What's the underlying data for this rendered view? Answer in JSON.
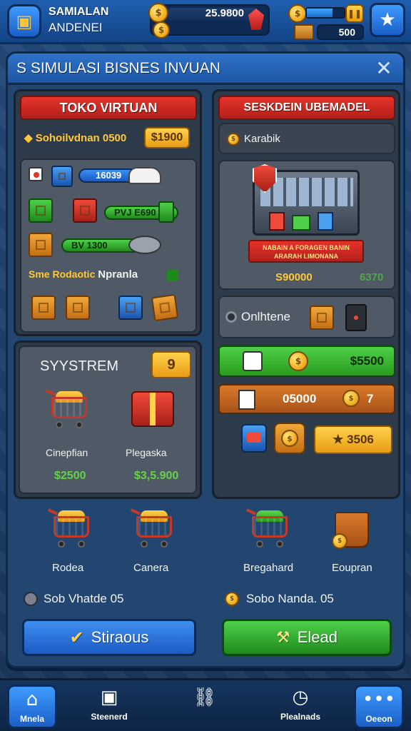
{
  "hud": {
    "title_line1": "SAMIALAN",
    "title_line2": "ANDENEI",
    "money": "25.9800",
    "box_value": "500",
    "energy_fraction": 0.7
  },
  "panel": {
    "title": "S SIMULASI BISNES INVUAN",
    "close": "✕"
  },
  "left": {
    "header": "TOKO VIRTUAN",
    "summary_label": "Sohoilvdnan 0500",
    "summary_value": "$1900",
    "bar1": "16039",
    "bar2": "PVJ E690",
    "bar3": "BV   1300",
    "status_label": "Sme Rodaotic",
    "status_value": "Npranla",
    "system_title": "SYYSTREM",
    "system_badge": "9",
    "item1_label": "Cinepfian",
    "item1_value": "$2500",
    "item2_label": "Plegaska",
    "item2_value": "$3,5.900"
  },
  "right": {
    "header": "SESKDEIN UBEMADEL",
    "sub_label": "Karabik",
    "banner": "NABAIN A FORAGEN BANIN ARARAH LIMONANA",
    "value1": "S90000",
    "value2": "6370",
    "online_label": "Onlhtene",
    "green_value": "$5500",
    "orange_value": "05000",
    "orange_count": "7",
    "yellow_value": "3506"
  },
  "carts": [
    {
      "label": "Rodea"
    },
    {
      "label": "Canera"
    },
    {
      "label": "Bregahard"
    },
    {
      "label": "Eoupran"
    }
  ],
  "footer": {
    "left_info": "Sob Vhatde 05",
    "right_info": "Sobo Nanda. 05",
    "btn_left": "Stiraous",
    "btn_right": "Elead"
  },
  "nav": [
    {
      "label": "Mnela",
      "icon": "home-icon"
    },
    {
      "label": "Steenerd",
      "icon": "frame-icon"
    },
    {
      "label": "",
      "icon": "chain-icon"
    },
    {
      "label": "Plealnads",
      "icon": "clock-icon"
    },
    {
      "label": "Oeeon",
      "icon": "chat-icon"
    }
  ]
}
